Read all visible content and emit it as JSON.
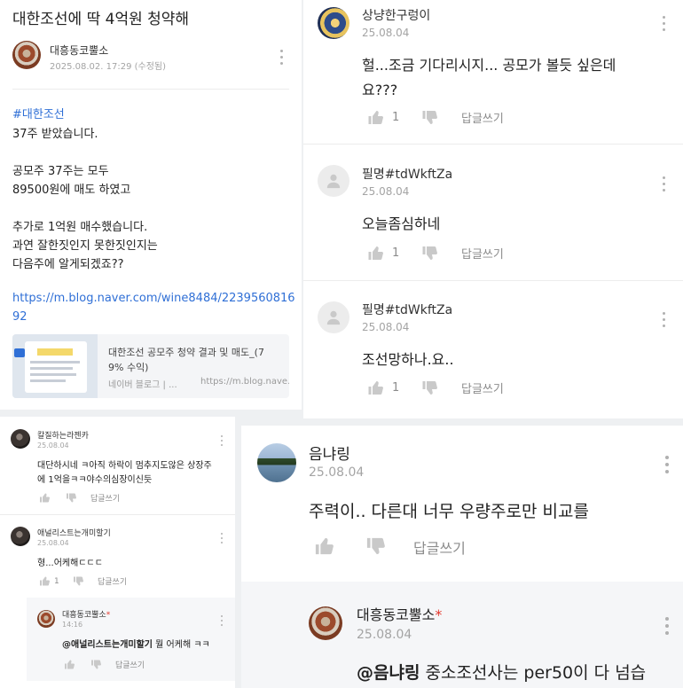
{
  "post": {
    "title": "대한조선에 딱 4억원 청약해",
    "author": "대흥동코뿔소",
    "datetime": "2025.08.02. 17:29 (수정됨)",
    "hashtag": "#대한조선",
    "lines": [
      "37주 받았습니다.",
      "공모주 37주는 모두",
      "89500원에 매도 하였고",
      "추가로 1억원 매수했습니다.",
      "과연 잘한짓인지 못한짓인지는",
      "다음주에 알게되겠죠??"
    ],
    "link_line1": "https://m.blog.naver.com/wine8484/2239560816",
    "link_line2": "92",
    "card": {
      "title_line1": "대한조선 공모주 청약 결과 및 매도_(7",
      "title_line2": "9% 수익)",
      "source": "네이버 블로그 | ...",
      "url": "https://m.blog.nave..."
    }
  },
  "left_comments": [
    {
      "name": "칼질하는라젠카",
      "date": "25.08.04",
      "text1": "대단하시네 ㅋ아직 하락이 멈추지도않은 상장주",
      "text2": "에 1억을ㅋㅋ야수의심장이신듯",
      "reply": "답글쓰기"
    },
    {
      "name": "애널리스트는개미할기",
      "date": "25.08.04",
      "text1": "형...어케해ㄷㄷㄷ",
      "likes": "1",
      "reply": "답글쓰기"
    },
    {
      "name": "대흥동코뿔소",
      "star": "*",
      "date": "14:16",
      "mention": "@애널리스트는개미할기",
      "text1": " 뭘 어케해 ㅋㅋ",
      "reply": "답글쓰기"
    }
  ],
  "right_comments": [
    {
      "name": "상냥한구렁이",
      "date": "25.08.04",
      "text1": "헐...조금 기다리시지... 공모가 볼듯 싶은데",
      "text2": "요???",
      "likes": "1",
      "reply": "답글쓰기"
    },
    {
      "name": "필명#tdWkftZa",
      "date": "25.08.04",
      "text1": "오늘좀심하네",
      "likes": "1",
      "reply": "답글쓰기"
    },
    {
      "name": "필명#tdWkftZa",
      "date": "25.08.04",
      "text1": "조선망하나.요..",
      "likes": "1",
      "reply": "답글쓰기"
    }
  ],
  "bottom_comments": [
    {
      "name": "음냐링",
      "date": "25.08.04",
      "text1": "주력이.. 다른대 너무 우량주로만 비교를",
      "reply": "답글쓰기"
    },
    {
      "name": "대흥동코뿔소",
      "star": "*",
      "date": "25.08.04",
      "mention": "@음냐링",
      "text1": " 중소조선사는 per50이 다 넘습"
    }
  ],
  "icons": [
    "kebab-menu-icon",
    "thumb-up-icon",
    "thumb-down-icon",
    "default-avatar-icon",
    "reply-indent-icon"
  ],
  "colors": {
    "link": "#2f6fd6",
    "star": "#e3362b",
    "muted": "#a4a4a4",
    "icon": "#c9c9c9"
  }
}
